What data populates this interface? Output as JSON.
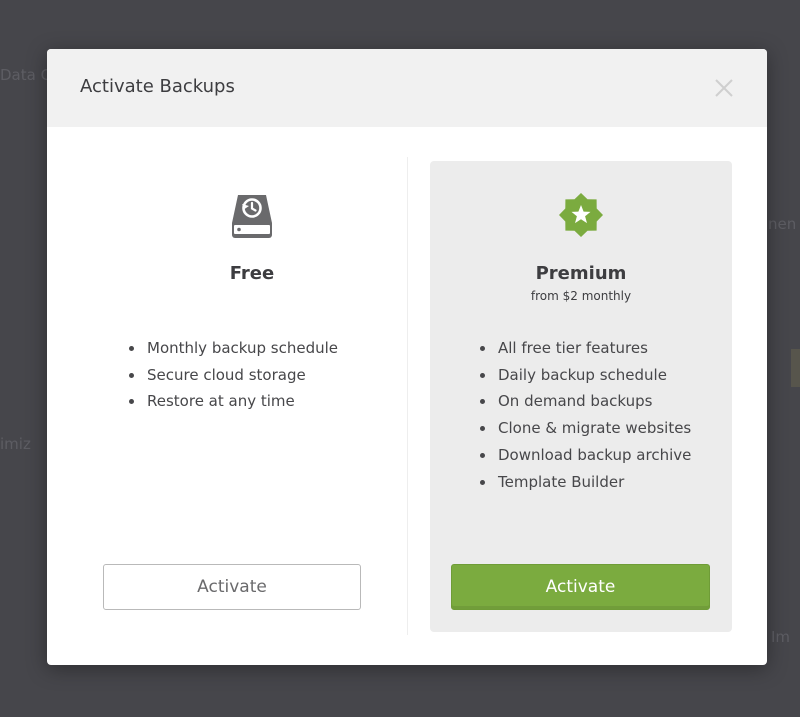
{
  "background": {
    "fragments": [
      "Data C",
      "nen",
      "imiz",
      "Im"
    ]
  },
  "modal": {
    "title": "Activate Backups",
    "close_icon": "close-icon"
  },
  "tiers": {
    "free": {
      "icon": "backup-drive-icon",
      "name": "Free",
      "features": [
        "Monthly backup schedule",
        "Secure cloud storage",
        "Restore at any time"
      ],
      "button_label": "Activate"
    },
    "premium": {
      "icon": "star-badge-icon",
      "name": "Premium",
      "price": "from $2 monthly",
      "features": [
        "All free tier features",
        "Daily backup schedule",
        "On demand backups",
        "Clone & migrate websites",
        "Download backup archive",
        "Template Builder"
      ],
      "button_label": "Activate"
    }
  },
  "colors": {
    "overlay": "#46464b",
    "accent": "#7bab3f",
    "premium_panel": "#ececec"
  }
}
